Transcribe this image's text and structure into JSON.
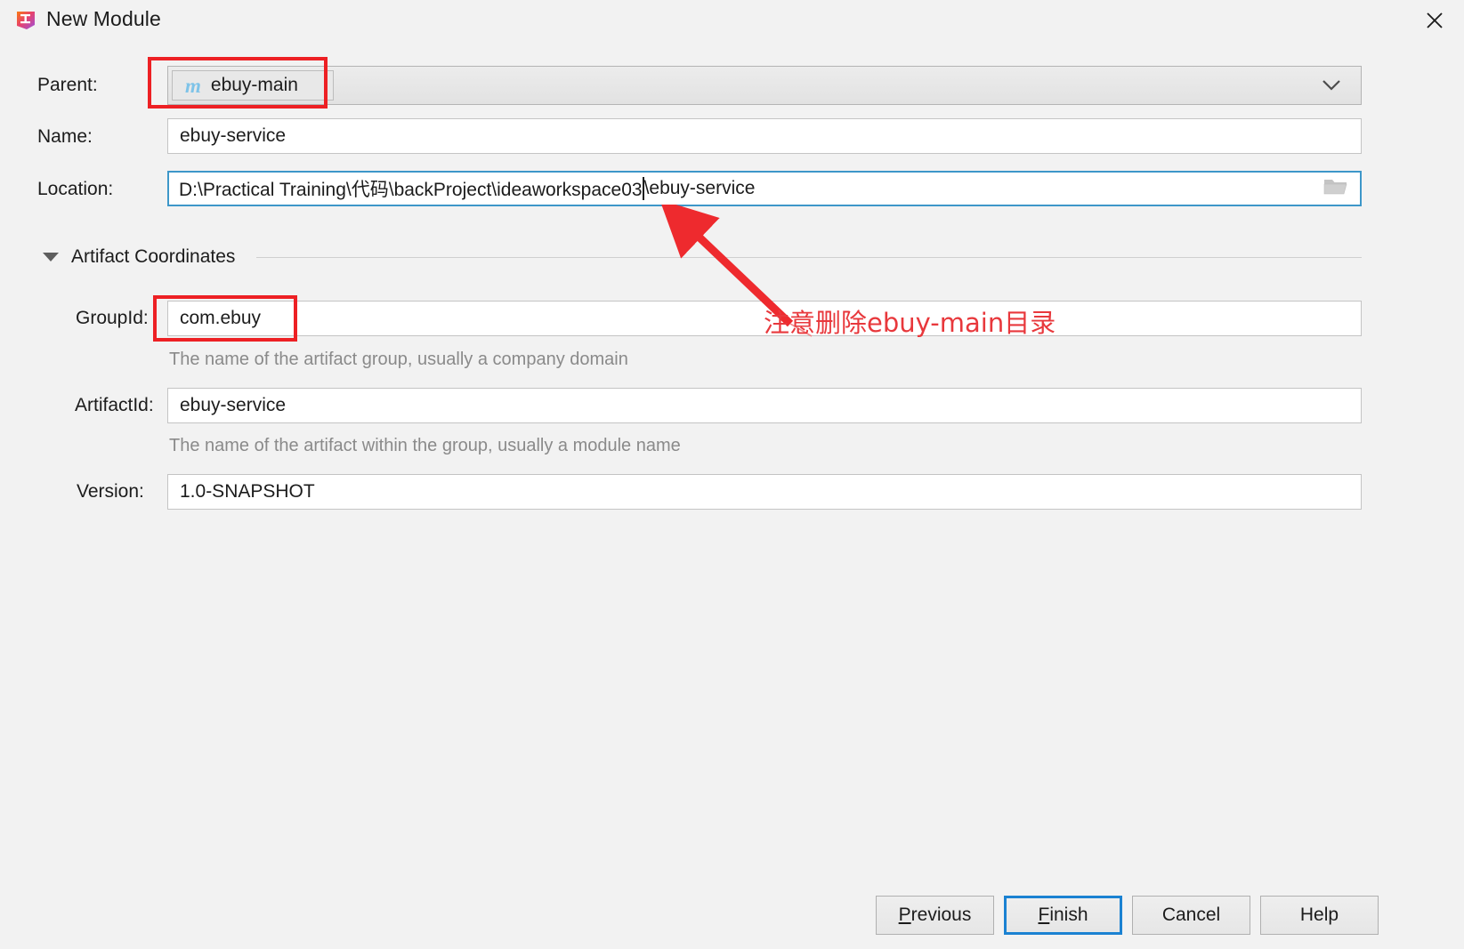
{
  "window": {
    "title": "New Module",
    "app_icon": "intellij-idea-icon",
    "close_icon": "close-icon"
  },
  "form": {
    "parent": {
      "label": "Parent:",
      "value": "ebuy-main",
      "icon": "maven-module-icon",
      "chevron": "chevron-down-icon",
      "highlighted": true
    },
    "name": {
      "label": "Name:",
      "value": "ebuy-service"
    },
    "location": {
      "label": "Location:",
      "value_before_caret": "D:\\Practical Training\\代码\\backProject\\ideaworkspace03",
      "value_after_caret": "\\ebuy-service",
      "full_value": "D:\\Practical Training\\代码\\backProject\\ideaworkspace03\\ebuy-service",
      "browse_icon": "folder-icon",
      "focused": true
    }
  },
  "artifact_section": {
    "title": "Artifact Coordinates",
    "expanded": true,
    "collapse_icon": "triangle-down-icon",
    "group_id": {
      "label": "GroupId:",
      "value": "com.ebuy",
      "hint": "The name of the artifact group, usually a company domain",
      "highlighted": true
    },
    "artifact_id": {
      "label": "ArtifactId:",
      "value": "ebuy-service",
      "hint": "The name of the artifact within the group, usually a module name"
    },
    "version": {
      "label": "Version:",
      "value": "1.0-SNAPSHOT"
    }
  },
  "annotation": {
    "text": "注意删除ebuy-main目录",
    "color": "#e8383c",
    "arrow": "red-arrow-icon",
    "highlight_color": "#ed2024"
  },
  "buttons": {
    "previous": {
      "label": "Previous",
      "mnemonic": "P",
      "default": false
    },
    "finish": {
      "label": "Finish",
      "mnemonic": "F",
      "default": true
    },
    "cancel": {
      "label": "Cancel",
      "mnemonic": "",
      "default": false
    },
    "help": {
      "label": "Help",
      "mnemonic": "",
      "default": false
    }
  }
}
